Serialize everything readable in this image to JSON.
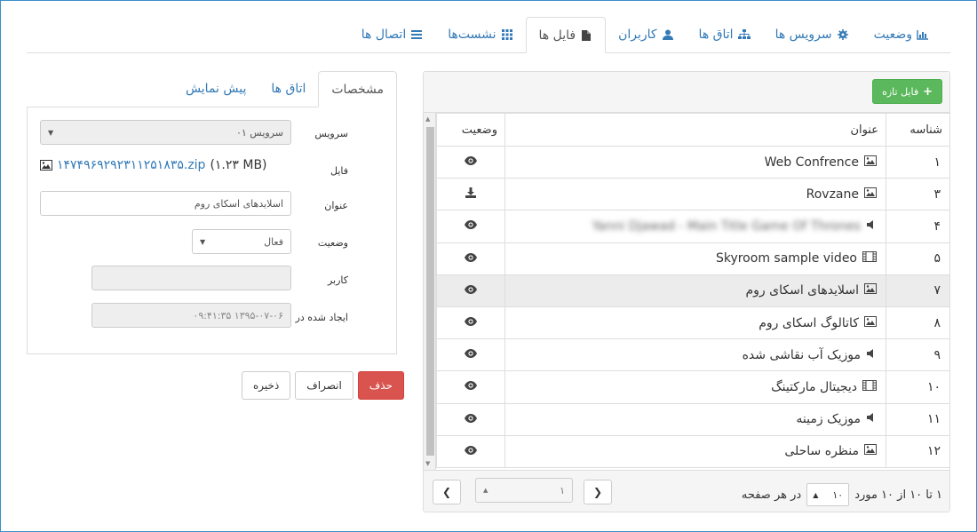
{
  "top_tabs": [
    {
      "label": "وضعیت",
      "icon": "bar-chart-icon"
    },
    {
      "label": "سرویس ها",
      "icon": "gear-icon"
    },
    {
      "label": "اتاق ها",
      "icon": "sitemap-icon"
    },
    {
      "label": "کاربران",
      "icon": "user-icon"
    },
    {
      "label": "فایل ها",
      "icon": "file-icon"
    },
    {
      "label": "نشست‌ها",
      "icon": "grid-icon"
    },
    {
      "label": "اتصال ها",
      "icon": "list-icon"
    }
  ],
  "files": {
    "new_button": "فایل تازه",
    "columns": {
      "id": "شناسه",
      "title": "عنوان",
      "status": "وضعیت"
    },
    "rows": [
      {
        "id": "۱",
        "title": "Web Confrence",
        "type": "image",
        "action": "view"
      },
      {
        "id": "۳",
        "title": "Rovzane",
        "type": "image",
        "action": "download"
      },
      {
        "id": "۴",
        "title": "Yanni Djawad - Main Title Game Of Thrones",
        "type": "audio",
        "action": "view",
        "blurred": true
      },
      {
        "id": "۵",
        "title": "Skyroom sample video",
        "type": "video",
        "action": "view"
      },
      {
        "id": "۷",
        "title": "اسلایدهای اسکای روم",
        "type": "image",
        "action": "view",
        "selected": true
      },
      {
        "id": "۸",
        "title": "کاتالوگ اسکای روم",
        "type": "image",
        "action": "view"
      },
      {
        "id": "۹",
        "title": "موزیک آب نقاشی شده",
        "type": "audio",
        "action": "view"
      },
      {
        "id": "۱۰",
        "title": "دیجیتال مارکتینگ",
        "type": "video",
        "action": "view"
      },
      {
        "id": "۱۱",
        "title": "موزیک زمینه",
        "type": "audio",
        "action": "view"
      },
      {
        "id": "۱۲",
        "title": "منظره ساحلی",
        "type": "image",
        "action": "view"
      }
    ],
    "pager": {
      "summary": "۱ تا ۱۰ از ۱۰ مورد",
      "per_page": "۱۰",
      "per_page_suffix": "در هر صفحه",
      "page": "۱"
    }
  },
  "details": {
    "tabs": [
      "مشخصات",
      "اتاق ها",
      "پیش نمایش"
    ],
    "labels": {
      "service": "سرویس",
      "file": "فایل",
      "title": "عنوان",
      "status": "وضعیت",
      "user": "کاربر",
      "created": "ایجاد شده در"
    },
    "service_value": "سرویس ۰۱",
    "file_name": "۱۴۷۴۹۶۹۲۹۲۳۱۱۲۵۱۸۳۵.zip",
    "file_size": "(۱.۲۳ MB)",
    "title_value": "اسلایدهای اسکای روم",
    "status_value": "فعال",
    "user_value": "",
    "created_value": "۱۳۹۵-۰۷-۰۶ ۰۹:۴۱:۳۵"
  },
  "actions": {
    "delete": "حذف",
    "cancel": "انصراف",
    "save": "ذخیره"
  },
  "colors": {
    "accent": "#337ab7",
    "success": "#5cb85c",
    "danger": "#d9534f"
  }
}
